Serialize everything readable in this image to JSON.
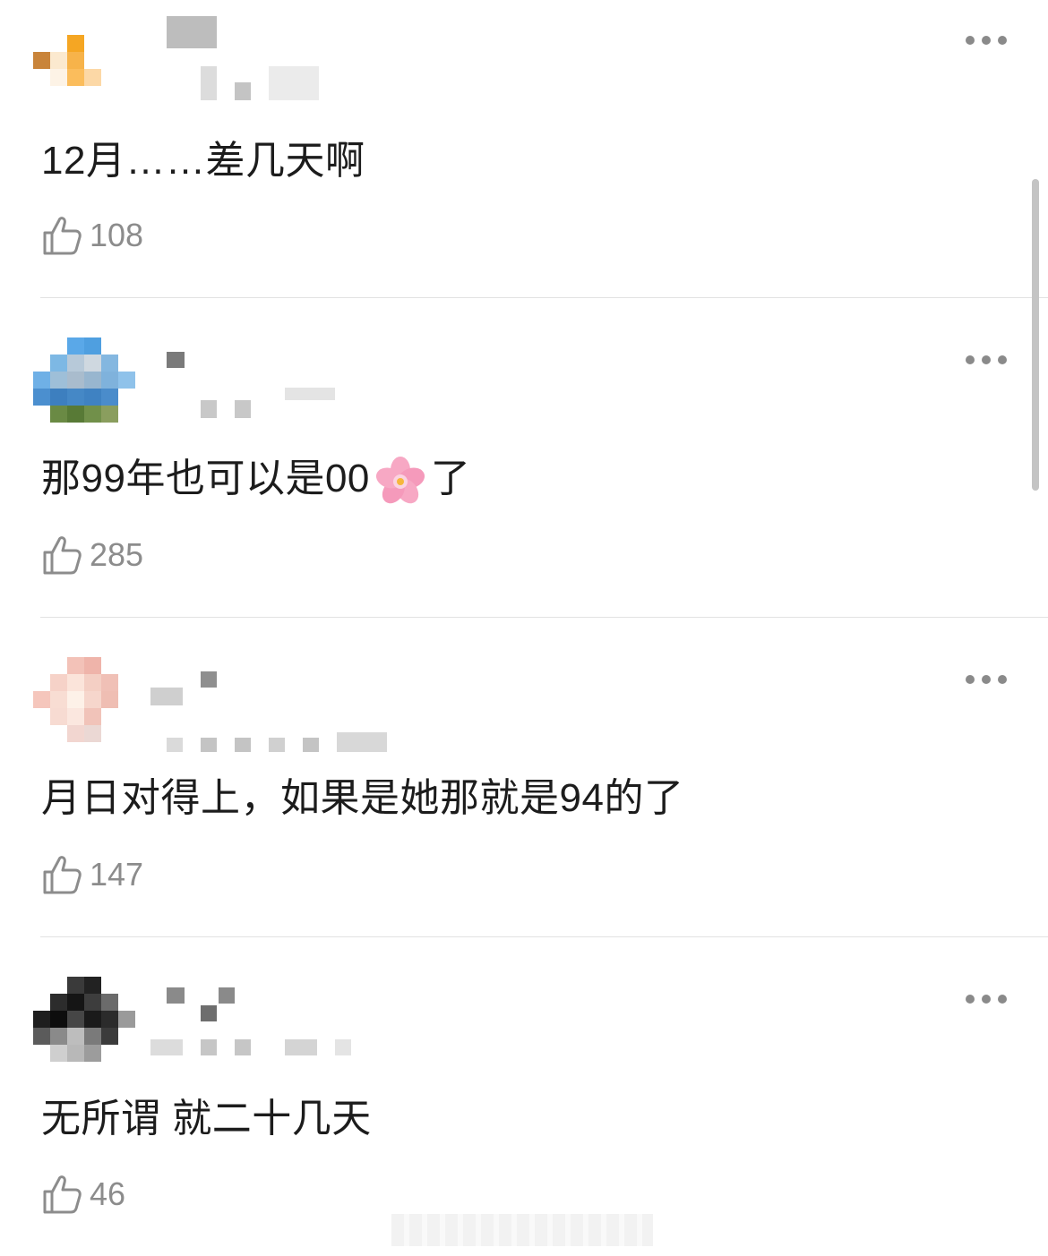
{
  "comments": [
    {
      "text": "12月……差几天啊",
      "likes": "108"
    },
    {
      "text_before": "那99年也可以是00",
      "emoji": "cherry-blossom",
      "text_after": "了",
      "likes": "285"
    },
    {
      "text": "月日对得上，如果是她那就是94的了",
      "likes": "147"
    },
    {
      "text": "无所谓 就二十几天",
      "likes": "46"
    }
  ],
  "icons": {
    "more": "more-icon",
    "like": "thumbs-up-icon"
  },
  "colors": {
    "like_gray": "#8c8c8c",
    "more_gray": "#8a8a8a",
    "divider": "#e2e2e2"
  }
}
